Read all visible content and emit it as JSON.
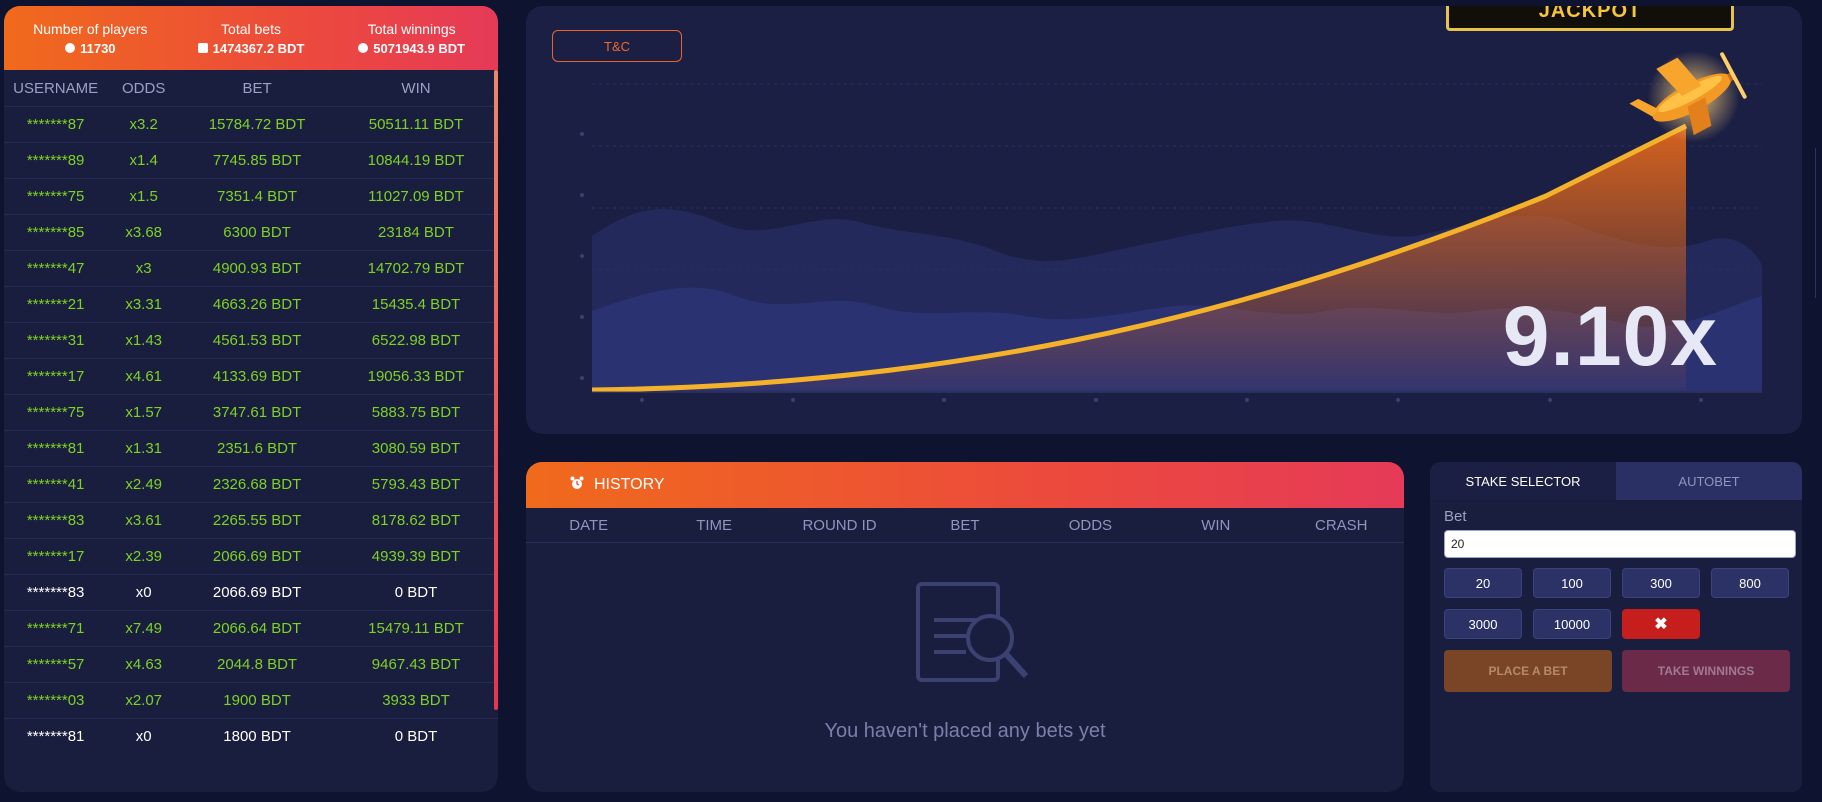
{
  "stats": {
    "players_label": "Number of players",
    "players_value": "11730",
    "bets_label": "Total bets",
    "bets_value": "1474367.2 BDT",
    "winnings_label": "Total winnings",
    "winnings_value": "5071943.9 BDT"
  },
  "table": {
    "headers": [
      "USERNAME",
      "ODDS",
      "BET",
      "WIN"
    ],
    "rows": [
      {
        "user": "*******87",
        "odds": "x3.2",
        "bet": "15784.72 BDT",
        "win": "50511.11 BDT",
        "status": "won"
      },
      {
        "user": "*******89",
        "odds": "x1.4",
        "bet": "7745.85 BDT",
        "win": "10844.19 BDT",
        "status": "won"
      },
      {
        "user": "*******75",
        "odds": "x1.5",
        "bet": "7351.4 BDT",
        "win": "11027.09 BDT",
        "status": "won"
      },
      {
        "user": "*******85",
        "odds": "x3.68",
        "bet": "6300 BDT",
        "win": "23184 BDT",
        "status": "won"
      },
      {
        "user": "*******47",
        "odds": "x3",
        "bet": "4900.93 BDT",
        "win": "14702.79 BDT",
        "status": "won"
      },
      {
        "user": "*******21",
        "odds": "x3.31",
        "bet": "4663.26 BDT",
        "win": "15435.4 BDT",
        "status": "won"
      },
      {
        "user": "*******31",
        "odds": "x1.43",
        "bet": "4561.53 BDT",
        "win": "6522.98 BDT",
        "status": "won"
      },
      {
        "user": "*******17",
        "odds": "x4.61",
        "bet": "4133.69 BDT",
        "win": "19056.33 BDT",
        "status": "won"
      },
      {
        "user": "*******75",
        "odds": "x1.57",
        "bet": "3747.61 BDT",
        "win": "5883.75 BDT",
        "status": "won"
      },
      {
        "user": "*******81",
        "odds": "x1.31",
        "bet": "2351.6 BDT",
        "win": "3080.59 BDT",
        "status": "won"
      },
      {
        "user": "*******41",
        "odds": "x2.49",
        "bet": "2326.68 BDT",
        "win": "5793.43 BDT",
        "status": "won"
      },
      {
        "user": "*******83",
        "odds": "x3.61",
        "bet": "2265.55 BDT",
        "win": "8178.62 BDT",
        "status": "won"
      },
      {
        "user": "*******17",
        "odds": "x2.39",
        "bet": "2066.69 BDT",
        "win": "4939.39 BDT",
        "status": "won"
      },
      {
        "user": "*******83",
        "odds": "x0",
        "bet": "2066.69 BDT",
        "win": "0 BDT",
        "status": "lost"
      },
      {
        "user": "*******71",
        "odds": "x7.49",
        "bet": "2066.64 BDT",
        "win": "15479.11 BDT",
        "status": "won"
      },
      {
        "user": "*******57",
        "odds": "x4.63",
        "bet": "2044.8 BDT",
        "win": "9467.43 BDT",
        "status": "won"
      },
      {
        "user": "*******03",
        "odds": "x2.07",
        "bet": "1900 BDT",
        "win": "3933 BDT",
        "status": "won"
      },
      {
        "user": "*******81",
        "odds": "x0",
        "bet": "1800 BDT",
        "win": "0 BDT",
        "status": "lost"
      }
    ]
  },
  "game": {
    "jackpot_label": "JACKPOT",
    "tc_label": "T&C",
    "multiplier": "9.10x",
    "plane_icon": "airplane-icon"
  },
  "history": {
    "title": "HISTORY",
    "title_icon": "alarm-clock-icon",
    "columns": [
      "DATE",
      "TIME",
      "ROUND ID",
      "BET",
      "ODDS",
      "WIN",
      "CRASH"
    ],
    "empty_icon": "document-search-icon",
    "empty_text": "You haven't placed any bets yet"
  },
  "bet_panel": {
    "tabs": [
      "STAKE SELECTOR",
      "AUTOBET"
    ],
    "bet_label": "Bet",
    "bet_value": "20",
    "chips": [
      "20",
      "100",
      "300",
      "800",
      "3000",
      "10000"
    ],
    "clear_label": "✖",
    "place_label": "PLACE A BET",
    "take_label": "TAKE WINNINGS"
  },
  "colors": {
    "accent_orange": "#f06a1c",
    "accent_red": "#e63a58",
    "win_green": "#7ed321",
    "background": "#0e1330"
  }
}
